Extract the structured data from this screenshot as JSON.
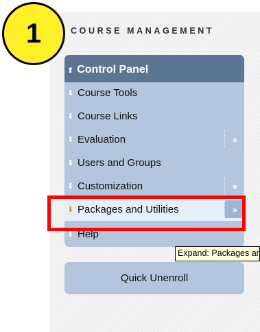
{
  "step": {
    "number": "1"
  },
  "section_title": "COURSE MANAGEMENT",
  "control_panel": {
    "header": "Control Panel",
    "header_icon": "chevron-up-double-icon",
    "items": [
      {
        "label": "Course Tools",
        "expandable": false,
        "active": false
      },
      {
        "label": "Course Links",
        "expandable": false,
        "active": false
      },
      {
        "label": "Evaluation",
        "expandable": true,
        "active": false
      },
      {
        "label": "Users and Groups",
        "expandable": false,
        "active": false
      },
      {
        "label": "Customization",
        "expandable": true,
        "active": false
      },
      {
        "label": "Packages and Utilities",
        "expandable": true,
        "active": true
      },
      {
        "label": "Help",
        "expandable": false,
        "active": false
      }
    ],
    "expand_glyph": "»",
    "collapse_glyph": "«"
  },
  "tooltip": "Expand: Packages and Utilities",
  "quick_unenroll": "Quick Unenroll",
  "colors": {
    "menu_bg": "#b3c6dd",
    "header_bg": "#5d7594",
    "highlight": "#ff0000",
    "badge": "#ffef29"
  }
}
